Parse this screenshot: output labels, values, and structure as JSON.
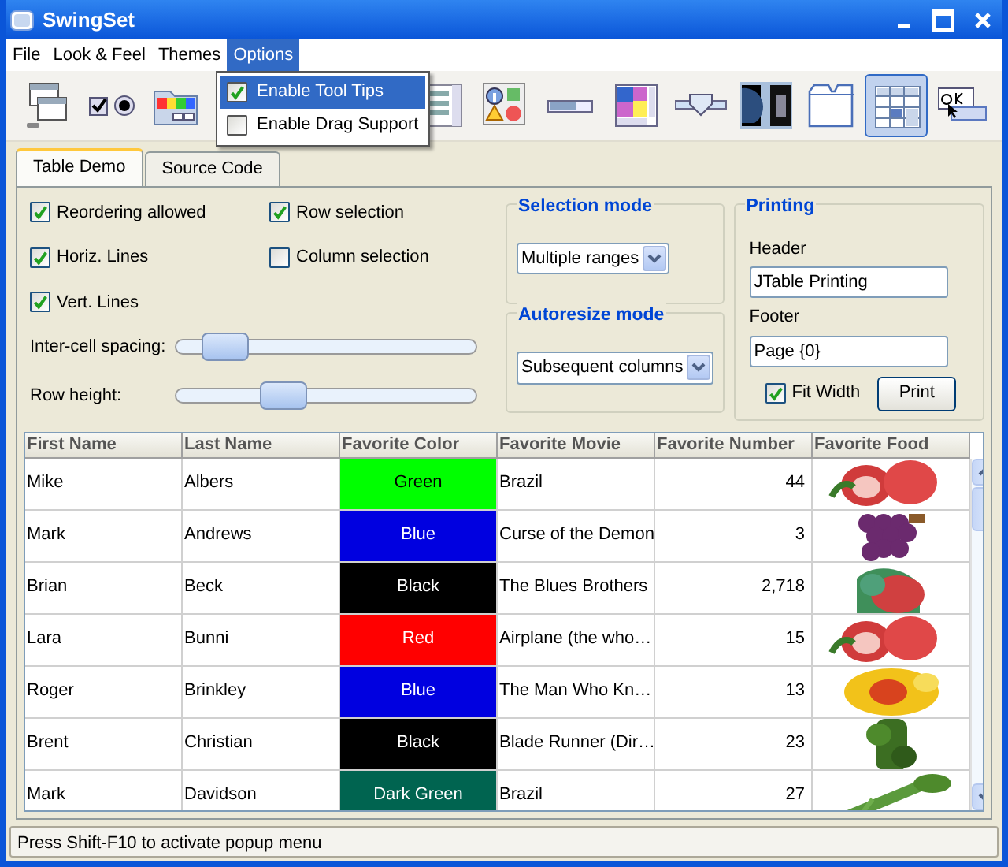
{
  "window": {
    "title": "SwingSet"
  },
  "menu": [
    {
      "label": "File",
      "selected": false
    },
    {
      "label": "Look & Feel",
      "selected": false
    },
    {
      "label": "Themes",
      "selected": false
    },
    {
      "label": "Options",
      "selected": true
    }
  ],
  "options_menu": [
    {
      "label": "Enable Tool Tips",
      "checked": true,
      "selected": true
    },
    {
      "label": "Enable Drag Support",
      "checked": false,
      "selected": false
    }
  ],
  "toolbar": [
    {
      "selected": false
    },
    {
      "selected": false
    },
    {
      "selected": false
    },
    {
      "selected": false
    },
    {
      "selected": false
    },
    {
      "selected": false
    },
    {
      "selected": false
    },
    {
      "selected": false
    },
    {
      "selected": false
    },
    {
      "selected": false
    },
    {
      "selected": true
    },
    {
      "selected": false
    }
  ],
  "tabs": [
    {
      "label": "Table Demo",
      "selected": true
    },
    {
      "label": "Source Code",
      "selected": false
    }
  ],
  "checkboxes": [
    {
      "label": "Reordering allowed",
      "checked": true
    },
    {
      "label": "Row selection",
      "checked": true
    },
    {
      "label": "Horiz. Lines",
      "checked": true
    },
    {
      "label": "Column selection",
      "checked": false
    },
    {
      "label": "Vert. Lines",
      "checked": true
    }
  ],
  "sliders": [
    {
      "label": "Inter-cell spacing:",
      "level": 0.1
    },
    {
      "label": "Row height:",
      "level": 0.33
    }
  ],
  "selection_mode": {
    "title": "Selection mode",
    "value": "Multiple ranges"
  },
  "autoresize_mode": {
    "title": "Autoresize mode",
    "value": "Subsequent columns"
  },
  "printing": {
    "title": "Printing",
    "header_label": "Header",
    "header_value": "JTable Printing",
    "footer_label": "Footer",
    "footer_value": "Page {0}",
    "fit_width": {
      "label": "Fit Width",
      "checked": true
    },
    "print_button": "Print"
  },
  "table": {
    "columns": [
      "First Name",
      "Last Name",
      "Favorite Color",
      "Favorite Movie",
      "Favorite Number",
      "Favorite Food"
    ],
    "rows": [
      {
        "first_name": "Mike",
        "last_name": "Albers",
        "color_name": "Green",
        "color": "#00ff00",
        "movie": "Brazil",
        "number": "44"
      },
      {
        "first_name": "Mark",
        "last_name": "Andrews",
        "color_name": "Blue",
        "color": "#0000e0",
        "movie": "Curse of the Demon",
        "number": "3"
      },
      {
        "first_name": "Brian",
        "last_name": "Beck",
        "color_name": "Black",
        "color": "#000000",
        "movie": "The Blues Brothers",
        "number": "2,718"
      },
      {
        "first_name": "Lara",
        "last_name": "Bunni",
        "color_name": "Red",
        "color": "#ff0000",
        "movie": "Airplane (the who…",
        "number": "15"
      },
      {
        "first_name": "Roger",
        "last_name": "Brinkley",
        "color_name": "Blue",
        "color": "#0000e0",
        "movie": "The Man Who Kn…",
        "number": "13"
      },
      {
        "first_name": "Brent",
        "last_name": "Christian",
        "color_name": "Black",
        "color": "#000000",
        "movie": "Blade Runner (Dir…",
        "number": "23"
      },
      {
        "first_name": "Mark",
        "last_name": "Davidson",
        "color_name": "Dark Green",
        "color": "#006450",
        "movie": "Brazil",
        "number": "27"
      }
    ]
  },
  "status_bar": "Press Shift-F10 to activate popup menu"
}
